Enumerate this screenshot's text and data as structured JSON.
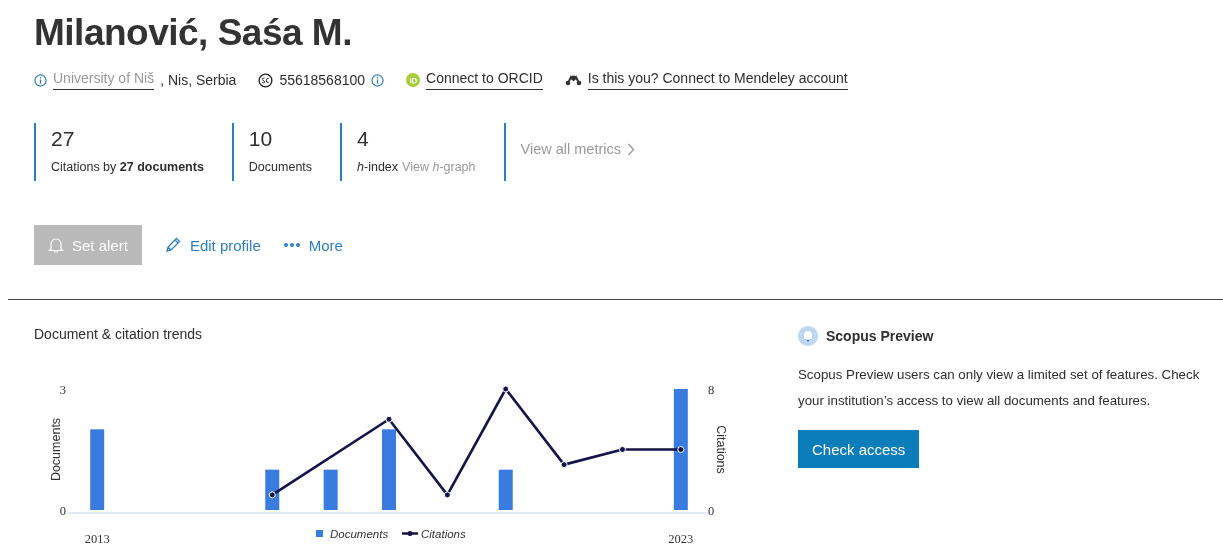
{
  "author": {
    "name": "Milanović, Saśa M.",
    "institution": "University of Niš",
    "location": ", Nis, Serbia",
    "author_id": "55618568100",
    "orcid_link": "Connect to ORCID",
    "mendeley_link": "Is this you? Connect to Mendeley account"
  },
  "metrics": [
    {
      "kind": "stat",
      "value": "27",
      "label": "Citations by **27 documents**"
    },
    {
      "kind": "stat",
      "value": "10",
      "label": "Documents"
    },
    {
      "kind": "stat",
      "value": "4",
      "label": "*h*-index",
      "link": "View *h*-graph"
    },
    {
      "kind": "link",
      "link": "View all metrics"
    }
  ],
  "actions": [
    {
      "kind": "alert",
      "label": "Set alert",
      "disabled": true
    },
    {
      "kind": "edit",
      "label": "Edit profile",
      "disabled": false
    },
    {
      "kind": "more",
      "label": "More",
      "disabled": false
    }
  ],
  "trends": {
    "title": "Document & citation trends",
    "documents": {
      "chart_data": {
        "type": "bar",
        "x": [
          2013,
          2014,
          2015,
          2016,
          2017,
          2018,
          2019,
          2020,
          2021,
          2022,
          2023
        ],
        "xlim": [
          2012.5,
          2023.5
        ],
        "xticks": [
          2013,
          2023
        ],
        "ylabel": "Documents",
        "yticks": [
          0,
          3
        ],
        "ylim": [
          0,
          3
        ],
        "series": [
          {
            "name": "Documents",
            "color": "#3a7be0",
            "values": [
              2,
              0,
              0,
              1,
              1,
              2,
              0,
              1,
              0,
              0,
              3
            ]
          }
        ]
      }
    },
    "citations": {
      "chart_data": {
        "type": "line",
        "x": [
          2016,
          2018,
          2019,
          2020,
          2021,
          2022,
          2023
        ],
        "xlim": [
          2012.5,
          2023.5
        ],
        "ylabel": "Citations",
        "yticks": [
          0,
          8
        ],
        "ylim": [
          0,
          8
        ],
        "series": [
          {
            "name": "Citations",
            "color": "#14134a",
            "marker": "o",
            "values": [
              1,
              6,
              1,
              8,
              3,
              4,
              4
            ]
          }
        ]
      }
    }
  },
  "preview": {
    "title": "Scopus Preview",
    "text": "Scopus Preview users can only view a limited set of features. Check your institution’s access to view all documents and features.",
    "button": "Check access"
  }
}
